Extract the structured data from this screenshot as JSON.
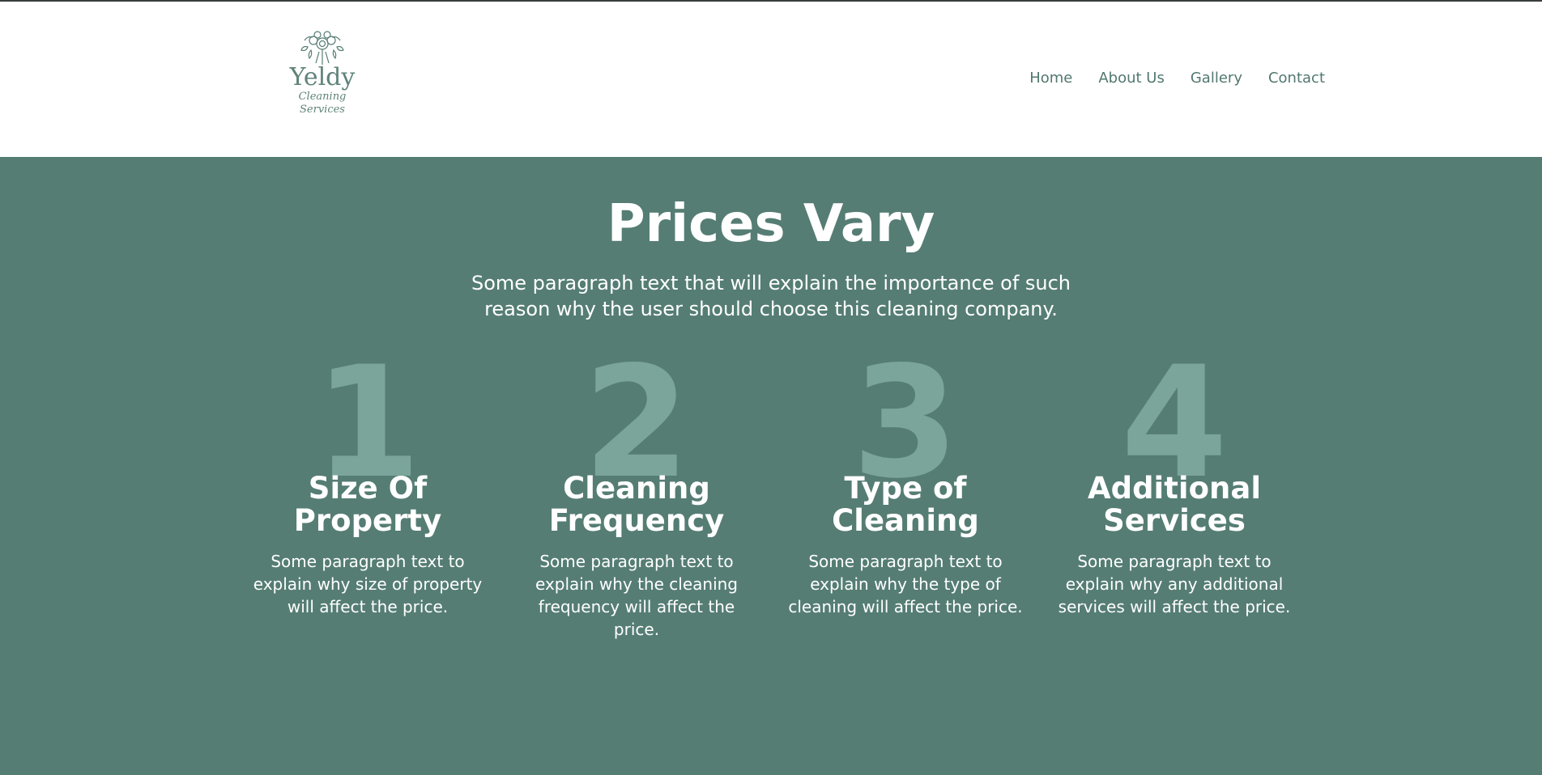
{
  "colors": {
    "brand": "#557d74",
    "nav_text": "#52786f",
    "number_tint": "#7ba49a",
    "white": "#ffffff"
  },
  "logo": {
    "name": "Yeldy",
    "tagline": "Cleaning Services",
    "icon": "flower-bouquet-icon"
  },
  "nav": {
    "items": [
      "Home",
      "About Us",
      "Gallery",
      "Contact"
    ]
  },
  "section": {
    "title": "Prices Vary",
    "intro": "Some paragraph text that will explain the importance of such reason why the user should choose this cleaning company.",
    "cards": [
      {
        "number": "1",
        "title": "Size Of Property",
        "text": "Some paragraph text to explain why size of property will affect the price."
      },
      {
        "number": "2",
        "title": "Cleaning Frequency",
        "text": "Some paragraph text to explain why the cleaning frequency will affect the price."
      },
      {
        "number": "3",
        "title": "Type of Cleaning",
        "text": "Some paragraph text to explain why the type of cleaning will affect the price."
      },
      {
        "number": "4",
        "title": "Additional Services",
        "text": "Some paragraph text to explain why any additional services will affect the price."
      }
    ]
  }
}
